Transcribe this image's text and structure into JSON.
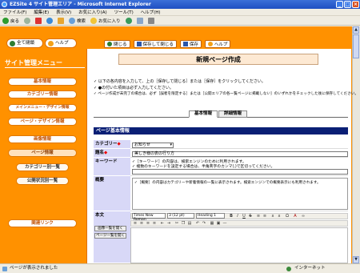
{
  "window": {
    "title": "EZSite 4 サイト管理エリア - Microsoft Internet Explorer"
  },
  "menubar": [
    "ファイル(F)",
    "編集(E)",
    "表示(V)",
    "お気に入り(A)",
    "ツール(T)",
    "ヘルプ(H)"
  ],
  "toolbar": {
    "back": "戻る",
    "search": "検索",
    "favorites": "お気に入り"
  },
  "sidebar": {
    "close_all": "全て閉鎖",
    "help": "ヘルプ",
    "title": "サイト管理メニュー",
    "items": [
      {
        "label": "基本情報"
      },
      {
        "label": "カテゴリー情報"
      },
      {
        "label": "メインメニュー・デザイン情報"
      },
      {
        "label": "ページ・デザイン情報"
      },
      {
        "label": "画像情報"
      },
      {
        "label": "ページ情報"
      },
      {
        "label": "カテゴリー別一覧"
      },
      {
        "label": "公開状況別一覧"
      },
      {
        "label": "関連リンク"
      }
    ]
  },
  "top_actions": {
    "close": "閉じる",
    "save_close": "保存して閉じる",
    "save": "保存",
    "help": "ヘルプ"
  },
  "page_title": "新規ページ作成",
  "notes": [
    "✓ 以下の各内容を入力して、上の［保存して閉じる］または［保存］をクリックしてください。",
    "✓ ●の付いた項目は必ず入力してください。",
    "✓ ページ作成が未完了の場合は、必ず［誤者を限定する］または［公開エリアの各一覧ページに掲載しない］のいずれかをチェックした後に保存してください。"
  ],
  "tabs": {
    "basic": "基本情報",
    "detail": "詳細情報"
  },
  "section_title": "ページ基本情報",
  "form": {
    "category_label": "カテゴリー",
    "category_value": "お知らせ",
    "title_label": "題名",
    "title_value": "美しき様の表の行り方",
    "keyword_label": "キーワード",
    "keyword_notes": [
      "✓［キーワード］の内容は、検索エンジンのために利用されます。",
      "✓ 複数のキーワードを設定する場合は、半角英字のカンマ(,)で区切ってください。"
    ],
    "summary_label": "概要",
    "summary_note": "✓［概要］の内容はカテゴリーや新着情報の一覧に表示されます。検索エンジンでの概要表示にも利用されます。",
    "body_label": "本文",
    "image_list_btn": "画像一覧を開く",
    "page_list_btn": "ページ一覧を開く"
  },
  "editor": {
    "font": "Times New Roman",
    "size": "3 (12 pt)",
    "format": "Heading 1"
  },
  "status": {
    "left": "ページが表示されました",
    "right": "インターネット"
  }
}
